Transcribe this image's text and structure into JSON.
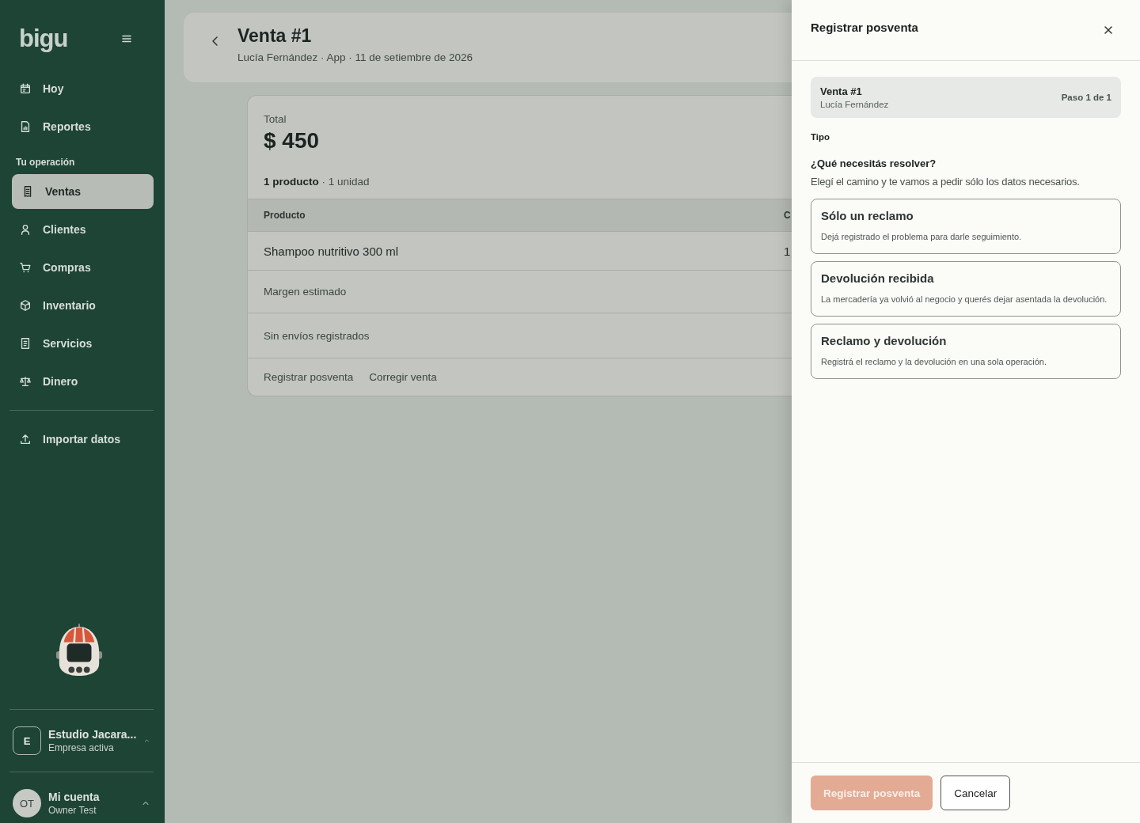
{
  "sidebar": {
    "logo": "bigu",
    "items": [
      {
        "label": "Hoy",
        "selected": false
      },
      {
        "label": "Reportes",
        "selected": false
      }
    ],
    "section_title": "Tu operación",
    "section_items": [
      {
        "label": "Ventas",
        "selected": true
      },
      {
        "label": "Clientes",
        "selected": false
      },
      {
        "label": "Compras",
        "selected": false
      },
      {
        "label": "Inventario",
        "selected": false
      },
      {
        "label": "Servicios",
        "selected": false
      },
      {
        "label": "Dinero",
        "selected": false
      }
    ],
    "footer_items": [
      {
        "label": "Importar datos",
        "selected": false
      }
    ],
    "company": {
      "initial": "E",
      "name": "Estudio Jacara...",
      "subtitle": "Empresa activa"
    },
    "account": {
      "initials": "OT",
      "name": "Mi cuenta",
      "subtitle": "Owner Test"
    }
  },
  "header": {
    "title": "Venta #1",
    "subtitle": "Lucía Fernández · App · 11 de setiembre de 2026"
  },
  "summary": {
    "label": "Total",
    "amount": "$ 450",
    "count": "**1 producto** · 1 unidad",
    "table": {
      "columns": [
        "Producto",
        "C"
      ],
      "rows": [
        [
          "Shampoo nutritivo 300 ml",
          "1"
        ]
      ]
    },
    "rows": [
      "Margen estimado",
      "Sin envíos registrados"
    ],
    "actions": [
      "Registrar posventa",
      "Corregir venta"
    ]
  },
  "panel": {
    "title": "Registrar posventa",
    "sale": {
      "title": "Venta #1",
      "customer": "Lucía Fernández",
      "step": "Paso 1 de 1"
    },
    "section_label": "Tipo",
    "question": "¿Qué necesitás resolver?",
    "hint": "Elegí el camino y te vamos a pedir sólo los datos necesarios.",
    "options": [
      {
        "title": "Sólo un reclamo",
        "description": "Dejá registrado el problema para darle seguimiento.",
        "selected": false
      },
      {
        "title": "Devolución recibida",
        "description": "La mercadería ya volvió al negocio y querés dejar asentada la devolución.",
        "selected": false
      },
      {
        "title": "Reclamo y devolución",
        "description": "Registrá el reclamo y la devolución en una sola operación.",
        "selected": false
      }
    ],
    "submit": {
      "label": "Registrar posventa",
      "disabled": true
    },
    "cancel": "Cancelar"
  }
}
